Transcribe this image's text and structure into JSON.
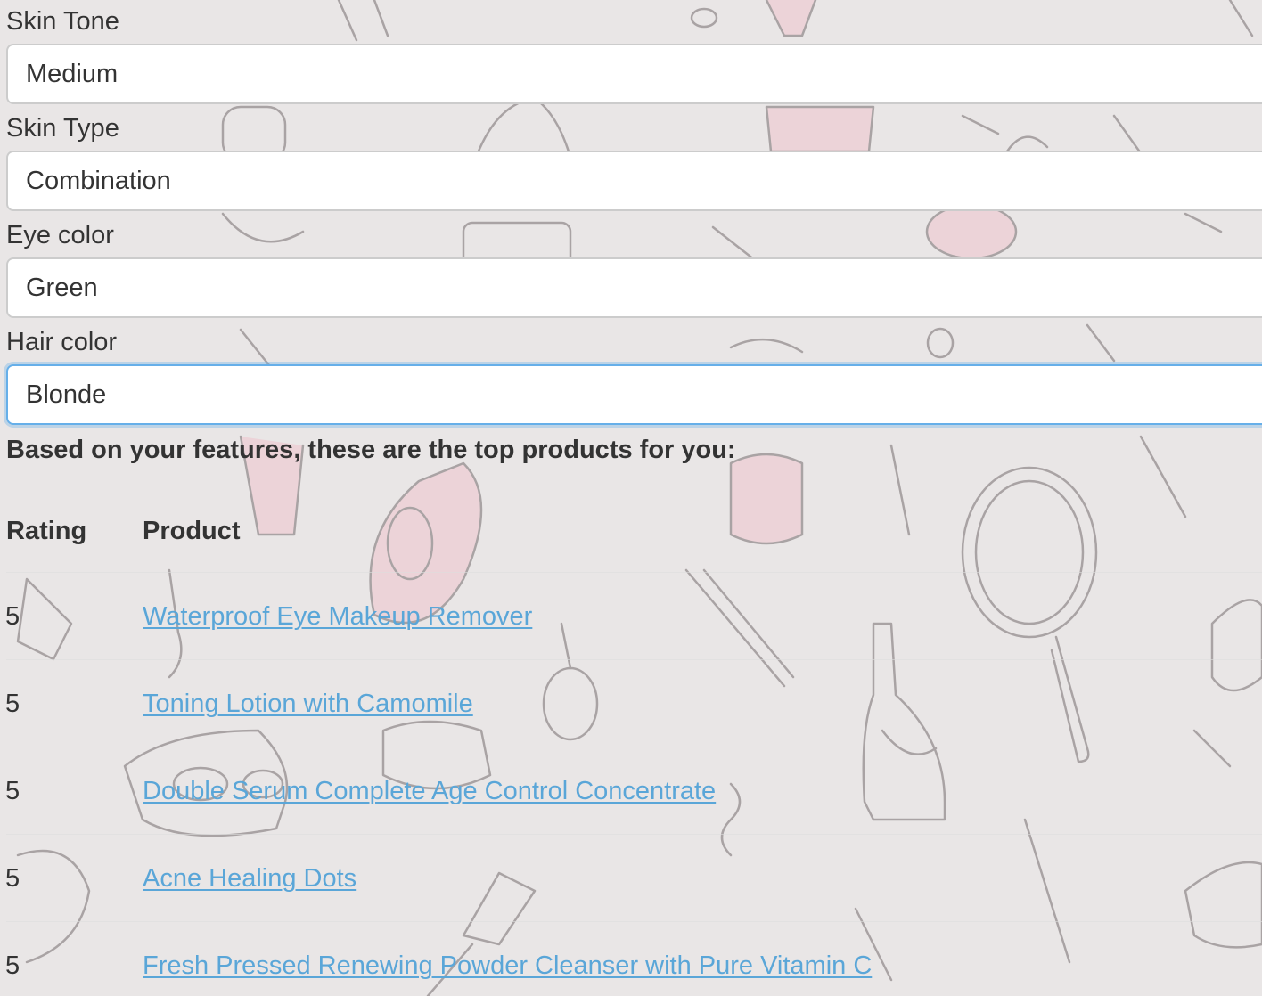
{
  "form": {
    "fields": [
      {
        "label": "Skin Tone",
        "value": "Medium"
      },
      {
        "label": "Skin Type",
        "value": "Combination"
      },
      {
        "label": "Eye color",
        "value": "Green"
      },
      {
        "label": "Hair color",
        "value": "Blonde"
      }
    ]
  },
  "results": {
    "intro": "Based on your features, these are the top products for you:",
    "columns": {
      "rating": "Rating",
      "product": "Product"
    },
    "rows": [
      {
        "rating": "5",
        "product": "Waterproof Eye Makeup Remover"
      },
      {
        "rating": "5",
        "product": "Toning Lotion with Camomile"
      },
      {
        "rating": "5",
        "product": "Double Serum Complete Age Control Concentrate"
      },
      {
        "rating": "5",
        "product": "Acne Healing Dots"
      },
      {
        "rating": "5",
        "product": "Fresh Pressed Renewing Powder Cleanser with Pure Vitamin C"
      }
    ]
  },
  "colors": {
    "link": "#5aa6d8",
    "focus_border": "#66afe9",
    "background": "#e9e6e6"
  }
}
